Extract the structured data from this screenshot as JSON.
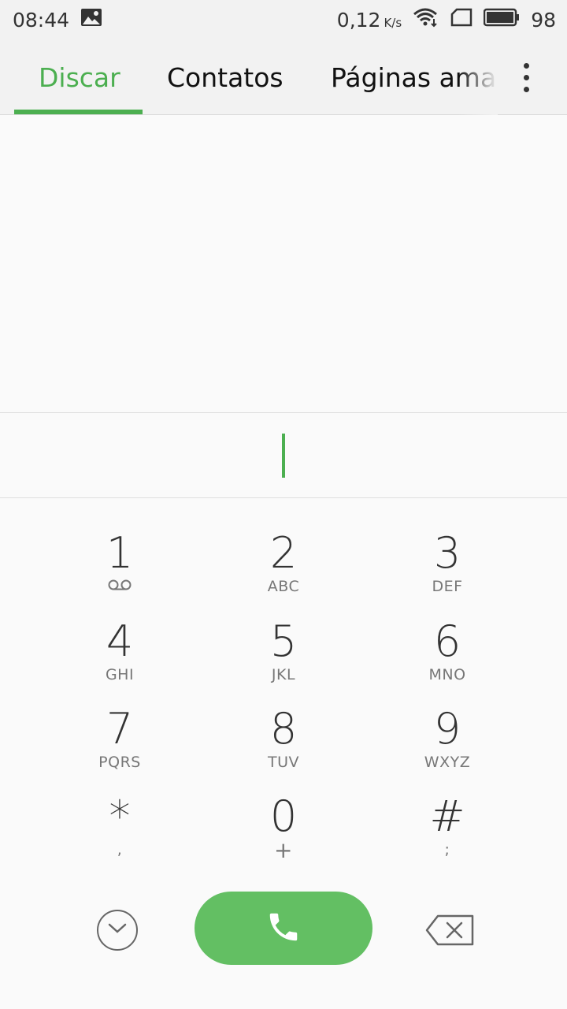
{
  "status_bar": {
    "time": "08:44",
    "speed_value": "0,12",
    "speed_unit": "K/s",
    "battery": "98"
  },
  "tabs": [
    {
      "label": "Discar",
      "active": true
    },
    {
      "label": "Contatos",
      "active": false
    },
    {
      "label": "Páginas ama",
      "active": false
    }
  ],
  "dial_input": {
    "value": ""
  },
  "keypad": [
    {
      "digit": "1",
      "sub": "",
      "sub_icon": "voicemail-icon"
    },
    {
      "digit": "2",
      "sub": "ABC"
    },
    {
      "digit": "3",
      "sub": "DEF"
    },
    {
      "digit": "4",
      "sub": "GHI"
    },
    {
      "digit": "5",
      "sub": "JKL"
    },
    {
      "digit": "6",
      "sub": "MNO"
    },
    {
      "digit": "7",
      "sub": "PQRS"
    },
    {
      "digit": "8",
      "sub": "TUV"
    },
    {
      "digit": "9",
      "sub": "WXYZ"
    },
    {
      "digit": "*",
      "sub": ","
    },
    {
      "digit": "0",
      "sub": "+"
    },
    {
      "digit": "#",
      "sub": ";"
    }
  ],
  "bottom_bar": {
    "collapse_icon": "chevron-down-icon",
    "call_icon": "phone-icon",
    "delete_icon": "backspace-icon"
  },
  "colors": {
    "accent": "#4caf50",
    "call_button": "#63bf63"
  }
}
